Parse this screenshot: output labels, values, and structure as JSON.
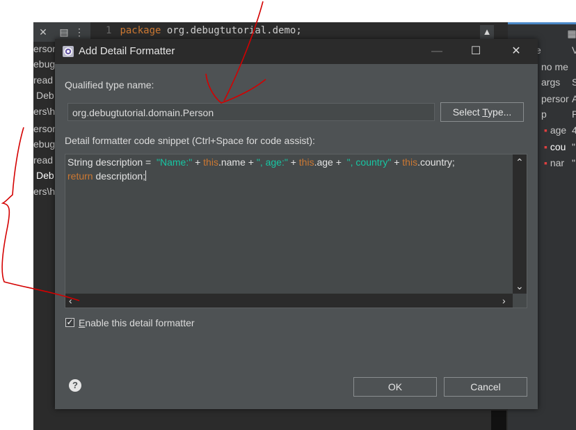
{
  "ide": {
    "editor_line_number": "1",
    "editor_keyword": "package",
    "editor_code": " org.debugtutorial.demo;",
    "left_rows": [
      "erson",
      "ebug",
      "read",
      "Deb",
      "ers\\h",
      "erson",
      "ebug",
      "read",
      "Deb",
      "ers\\h"
    ],
    "right_header": [
      "e",
      "V"
    ],
    "right_rows": [
      {
        "name": "no me",
        "value": ""
      },
      {
        "name": "args",
        "value": "S"
      },
      {
        "name": "persor",
        "value": "A"
      },
      {
        "name": "p",
        "value": "P"
      }
    ],
    "right_fields": [
      {
        "name": "age",
        "value": "4"
      },
      {
        "name": "cou",
        "value": "\""
      },
      {
        "name": "nar",
        "value": "\""
      }
    ]
  },
  "dialog": {
    "title": "Add Detail Formatter",
    "minimize_glyph": "—",
    "maximize_glyph": "☐",
    "close_glyph": "✕",
    "qualified_label": "Qualified type name:",
    "qualified_value": "org.debugtutorial.domain.Person",
    "select_type_prefix": "Select ",
    "select_type_mnemonic": "T",
    "select_type_suffix": "ype...",
    "snippet_label": "Detail formatter code snippet (Ctrl+Space for code assist):",
    "code": {
      "line1_a": "String description =  ",
      "line1_s1": "\"Name:\"",
      "line1_b": " + ",
      "line1_t1": "this",
      "line1_c": ".name + ",
      "line1_s2": "\", age:\"",
      "line1_d": " + ",
      "line1_t2": "this",
      "line1_e": ".age +  ",
      "line1_s3": "\", country\"",
      "line1_f": " + ",
      "line1_t3": "this",
      "line1_g": ".country;",
      "line2_kw": "return",
      "line2_rest": " description;"
    },
    "enable_mnemonic": "E",
    "enable_rest": "nable this detail formatter",
    "enable_checked": true,
    "help_glyph": "?",
    "ok_label": "OK",
    "cancel_label": "Cancel"
  },
  "colors": {
    "dialog_bg": "#4e5254",
    "titlebar_bg": "#2b2b2b",
    "string": "#17c6a3",
    "keyword": "#cc7832",
    "annotation": "#d40000"
  }
}
